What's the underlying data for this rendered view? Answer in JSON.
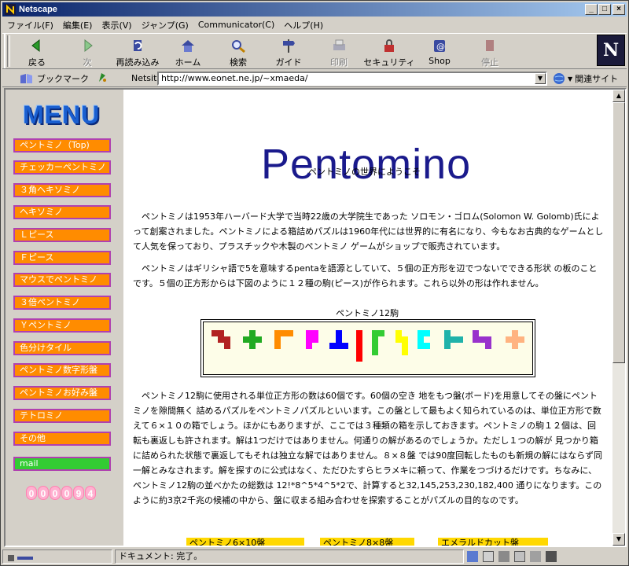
{
  "window": {
    "title": "Netscape"
  },
  "menubar": [
    "ファイル(F)",
    "編集(E)",
    "表示(V)",
    "ジャンプ(G)",
    "Communicator(C)",
    "ヘルプ(H)"
  ],
  "toolbar": [
    {
      "label": "戻る",
      "icon": "back-arrow-icon",
      "enabled": true
    },
    {
      "label": "次",
      "icon": "forward-arrow-icon",
      "enabled": false
    },
    {
      "label": "再読み込み",
      "icon": "reload-icon",
      "enabled": true
    },
    {
      "label": "ホーム",
      "icon": "home-icon",
      "enabled": true
    },
    {
      "label": "検索",
      "icon": "search-icon",
      "enabled": true
    },
    {
      "label": "ガイド",
      "icon": "guide-icon",
      "enabled": true
    },
    {
      "label": "印刷",
      "icon": "print-icon",
      "enabled": false
    },
    {
      "label": "セキュリティ",
      "icon": "lock-icon",
      "enabled": true
    },
    {
      "label": "Shop",
      "icon": "shop-icon",
      "enabled": true
    },
    {
      "label": "停止",
      "icon": "stop-icon",
      "enabled": false
    }
  ],
  "location": {
    "bookmarks_label": "ブックマーク",
    "netsite_label": "Netsite:",
    "url": "http://www.eonet.ne.jp/~xmaeda/",
    "related_label": "関連サイト"
  },
  "logo": {
    "letter": "N"
  },
  "sidebar": {
    "menu_title": "MENU",
    "links": [
      "ペントミノ（Top)",
      "チェッカーペントミノ",
      "３角ヘキソミノ",
      "ヘキソミノ",
      "Ｌピース",
      "Ｆピース",
      "マウスでペントミノ",
      "３倍ペントミノ",
      "Ｙペントミノ",
      "色分けタイル",
      "ペントミノ数字形盤",
      "ペントミノお好み盤",
      "テトロミノ",
      "その他"
    ],
    "mail_label": "mail",
    "counter": [
      "0",
      "0",
      "0",
      "0",
      "9",
      "4"
    ]
  },
  "main": {
    "title": "Pentomino",
    "subtitle": "ペントミノの世界にようこそ",
    "para1": "　ペントミノは1953年ハーバード大学で当時22歳の大学院生であった ソロモン・ゴロム(Solomon W. Golomb)氏によって創案されました。ペントミノによる箱詰めパズルは1960年代には世界的に有名になり、今もなお古典的なゲームとして人気を保っており、プラスチックや木製のペントミノ ゲームがショップで販売されています。",
    "para2": "　ペントミノはギリシャ語で5を意味するpentaを語源としていて、５個の正方形を辺でつないでできる形状 の板のことです。５個の正方形からは下図のように１２種の駒(ピース)が作られます。これら以外の形は作れません。",
    "caption": "ペントミノ12駒",
    "para3": "　ペントミノ12駒に使用される単位正方形の数は60個です。60個の空き 地をもつ盤(ボード)を用意してその盤にペントミノを隙間無く 詰めるパズルをペントミノパズルといいます。この盤として最もよく知られているのは、単位正方形で数えて６×１０の箱でしょう。ほかにもありますが、ここでは３種類の箱を示しておきます。ペントミノの駒１２個は、回転も裏返しも許されます。解は1つだけではありません。何通りの解があるのでしょうか。ただし１つの解が 見つかり箱に詰められた状態で裏返してもそれは独立な解ではありません。８×８盤 では90度回転したものも新規の解にはならず同一解とみなされます。解を探すのに公式はなく、ただひたすらヒラメキに頼って、作業をつづけるだけです。ちなみに、ペントミノ12駒の並べかたの総数は 12!*8^5*4^5*2で、計算すると32,145,253,230,182,400 通りになります。このように約3京2千兆の候補の中から、盤に収まる組み合わせを探索することがパズルの目的なのです。",
    "bottom_tabs": [
      "ペントミノ6×10盤",
      "ペントミノ8×8盤",
      "エメラルドカット盤"
    ]
  },
  "pieces": [
    {
      "color": "#b22222"
    },
    {
      "color": "#22aa22"
    },
    {
      "color": "#ff8c00"
    },
    {
      "color": "#ff00ff"
    },
    {
      "color": "#0000ff"
    },
    {
      "color": "#ff0000"
    },
    {
      "color": "#33cc33"
    },
    {
      "color": "#ffff00"
    },
    {
      "color": "#00ffff"
    },
    {
      "color": "#20b2aa"
    },
    {
      "color": "#9932cc"
    },
    {
      "color": "#ffb380"
    }
  ],
  "status": {
    "text": "ドキュメント: 完了。"
  }
}
